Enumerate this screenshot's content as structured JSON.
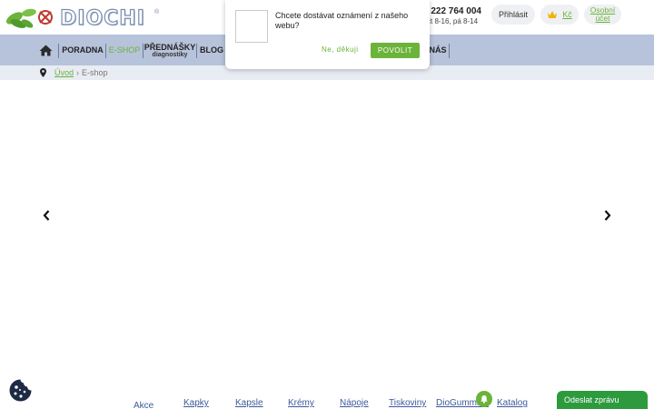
{
  "header": {
    "logo_text": "DIOCHI",
    "logo_reg": "®",
    "phone": "0 222 764 004",
    "hours": "čt 8-16, pá 8-14",
    "login_label": "Přihlásit",
    "cart_currency": "Kč",
    "account_line1": "Osobní",
    "account_line2": "účet"
  },
  "nav": {
    "items": [
      {
        "label": "PORADNA"
      },
      {
        "label": "E-SHOP"
      },
      {
        "label": "PŘEDNÁŠKY",
        "sub": "diagnostiky"
      },
      {
        "label": "BLOG"
      },
      {
        "label": "NÁS"
      }
    ]
  },
  "breadcrumb": {
    "home": "Úvod",
    "separator": "›",
    "current": "E-shop"
  },
  "popup": {
    "text": "Chcete dostávat oznámení z našeho webu?",
    "no_label": "Ne, děkuji",
    "yes_label": "POVOLIT"
  },
  "categories": [
    "Akce",
    "Kapky",
    "Kapsle",
    "Krémy",
    "Nápoje",
    "Tiskoviny",
    "DioGummies",
    "Katalog"
  ],
  "chat": {
    "label": "Odeslat zprávu"
  },
  "colors": {
    "accent_green": "#6bb33a",
    "nav_bg": "#b7c3db",
    "breadcrumb_bg": "#e8ecf3",
    "chat_bg": "#2e9a3e",
    "link_blue": "#3c5a9a"
  },
  "icons": [
    "leaf-logo-icon",
    "home-icon",
    "map-pin-icon",
    "crown-cart-icon",
    "chevron-left-icon",
    "chevron-right-icon",
    "cookie-icon",
    "bell-icon"
  ]
}
